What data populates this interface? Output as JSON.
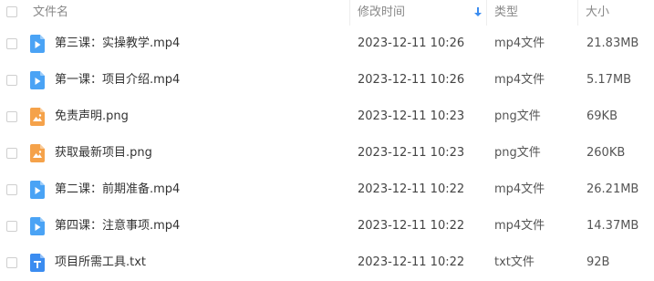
{
  "header": {
    "name_label": "文件名",
    "modified_label": "修改时间",
    "type_label": "类型",
    "size_label": "大小",
    "sort_direction": "descending"
  },
  "colors": {
    "video_icon": "#4aa3f5",
    "image_icon": "#f5a24a",
    "text_icon": "#3b8cf0",
    "sort_arrow": "#3b8cf0"
  },
  "files": [
    {
      "icon": "video-file-icon",
      "name": "第三课：实操教学.mp4",
      "modified": "2023-12-11 10:26",
      "type": "mp4文件",
      "size": "21.83MB"
    },
    {
      "icon": "video-file-icon",
      "name": "第一课：项目介绍.mp4",
      "modified": "2023-12-11 10:26",
      "type": "mp4文件",
      "size": "5.17MB"
    },
    {
      "icon": "image-file-icon",
      "name": "免责声明.png",
      "modified": "2023-12-11 10:23",
      "type": "png文件",
      "size": "69KB"
    },
    {
      "icon": "image-file-icon",
      "name": "获取最新项目.png",
      "modified": "2023-12-11 10:23",
      "type": "png文件",
      "size": "260KB"
    },
    {
      "icon": "video-file-icon",
      "name": "第二课：前期准备.mp4",
      "modified": "2023-12-11 10:22",
      "type": "mp4文件",
      "size": "26.21MB"
    },
    {
      "icon": "video-file-icon",
      "name": "第四课：注意事项.mp4",
      "modified": "2023-12-11 10:22",
      "type": "mp4文件",
      "size": "14.37MB"
    },
    {
      "icon": "text-file-icon",
      "name": "项目所需工具.txt",
      "modified": "2023-12-11 10:22",
      "type": "txt文件",
      "size": "92B"
    }
  ]
}
